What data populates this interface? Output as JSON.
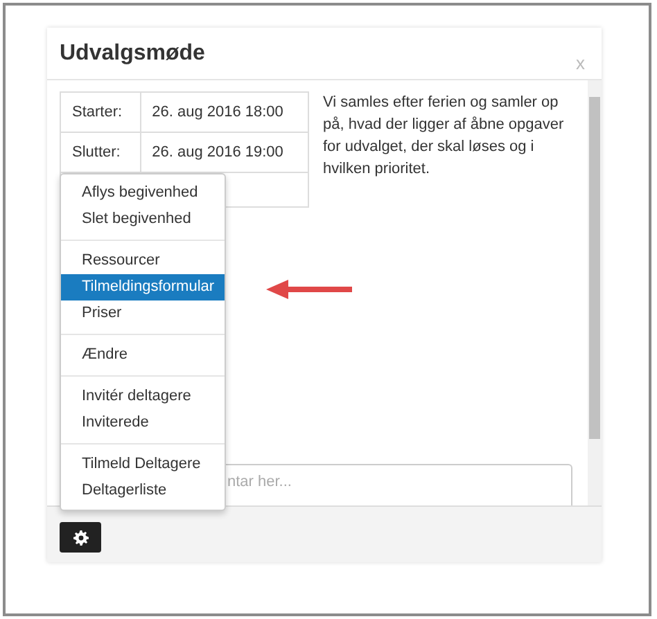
{
  "dialog": {
    "title": "Udvalgsmøde",
    "close": "x"
  },
  "details": [
    {
      "label": "Starter:",
      "value": "26. aug 2016 18:00"
    },
    {
      "label": "Slutter:",
      "value": "26. aug 2016 19:00"
    }
  ],
  "description": "Vi samles efter ferien og samler op på, hvad der ligger af åbne opgaver for udvalget, der skal løses og i hvilken prioritet.",
  "comment": {
    "placeholder": "ntar her..."
  },
  "menu": {
    "groups": [
      [
        {
          "label": "Aflys begivenhed",
          "selected": false
        },
        {
          "label": "Slet begivenhed",
          "selected": false
        }
      ],
      [
        {
          "label": "Ressourcer",
          "selected": false
        },
        {
          "label": "Tilmeldingsformular",
          "selected": true
        },
        {
          "label": "Priser",
          "selected": false
        }
      ],
      [
        {
          "label": "Ændre",
          "selected": false
        }
      ],
      [
        {
          "label": "Invitér deltagere",
          "selected": false
        },
        {
          "label": "Inviterede",
          "selected": false
        }
      ],
      [
        {
          "label": "Tilmeld Deltagere",
          "selected": false
        },
        {
          "label": "Deltagerliste",
          "selected": false
        }
      ]
    ]
  }
}
